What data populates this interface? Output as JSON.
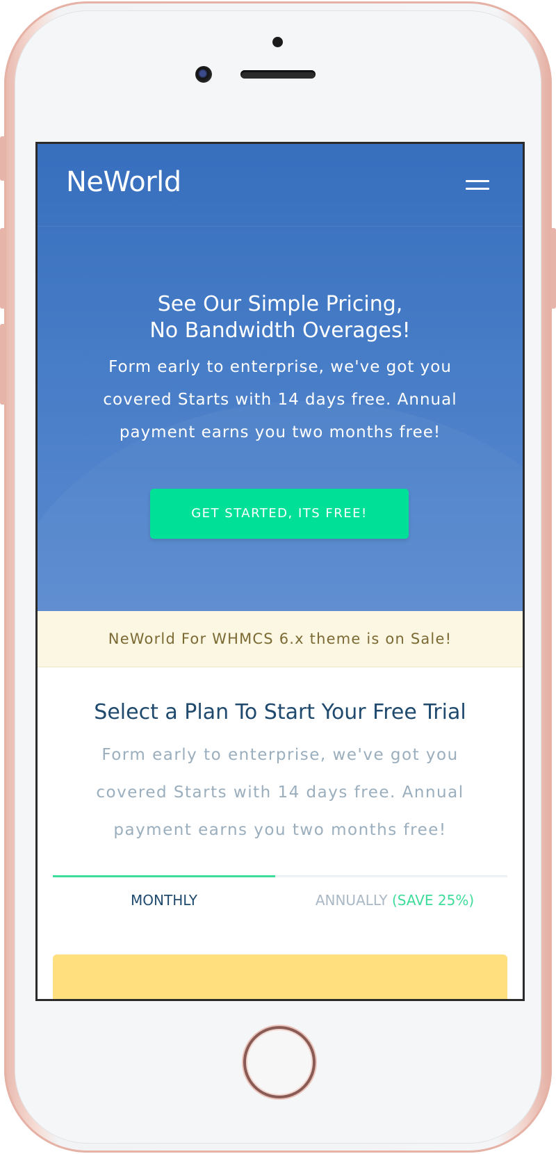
{
  "header": {
    "logo": "NeWorld",
    "menu_icon": "hamburger-menu-icon"
  },
  "hero": {
    "title_line1": "See Our Simple Pricing,",
    "title_line2": "No Bandwidth Overages!",
    "text": "Form early to enterprise, we've got you covered Starts with 14 days free. Annual payment earns you two months free!",
    "cta_label": "GET STARTED, ITS FREE!"
  },
  "banner": {
    "text": "NeWorld For WHMCS 6.x theme is on Sale!"
  },
  "plans": {
    "title": "Select a Plan To Start Your Free Trial",
    "text": "Form early to enterprise, we've got you covered Starts with 14 days free. Annual payment earns you two months free!",
    "tabs": {
      "monthly": "MONTHLY",
      "annually": "ANNUALLY",
      "annually_save": "(SAVE 25%)"
    }
  },
  "colors": {
    "hero_blue": "#376fbe",
    "cta_green": "#00e096",
    "banner_bg": "#fbf7e2",
    "card_yellow": "#ffdf7e"
  }
}
